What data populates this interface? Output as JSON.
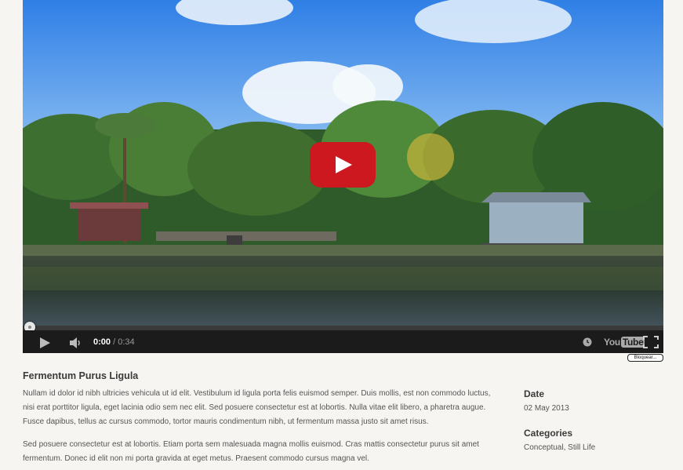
{
  "video": {
    "current_time": "0:00",
    "separator": " / ",
    "duration": "0:34",
    "progress_fraction": 0,
    "youtube_logo_you": "You",
    "youtube_logo_tube": "Tube",
    "bloquear_label": "Bloquear..."
  },
  "post": {
    "title": "Fermentum Purus Ligula",
    "paragraphs": [
      "Nullam id dolor id nibh ultricies vehicula ut id elit. Vestibulum id ligula porta felis euismod semper. Duis mollis, est non commodo luctus, nisi erat porttitor ligula, eget lacinia odio sem nec elit. Sed posuere consectetur est at lobortis. Nulla vitae elit libero, a pharetra augue. Fusce dapibus, tellus ac cursus commodo, tortor mauris condimentum nibh, ut fermentum massa justo sit amet risus.",
      "Sed posuere consectetur est at lobortis. Etiam porta sem malesuada magna mollis euismod. Cras mattis consectetur purus sit amet fermentum. Donec id elit non mi porta gravida at eget metus. Praesent commodo cursus magna vel."
    ]
  },
  "meta": {
    "date_label": "Date",
    "date_value": "02 May 2013",
    "categories_label": "Categories",
    "categories_value": "Conceptual, Still Life"
  },
  "colors": {
    "play_button": "#cc181e",
    "control_bar": "#1b1b1b"
  }
}
